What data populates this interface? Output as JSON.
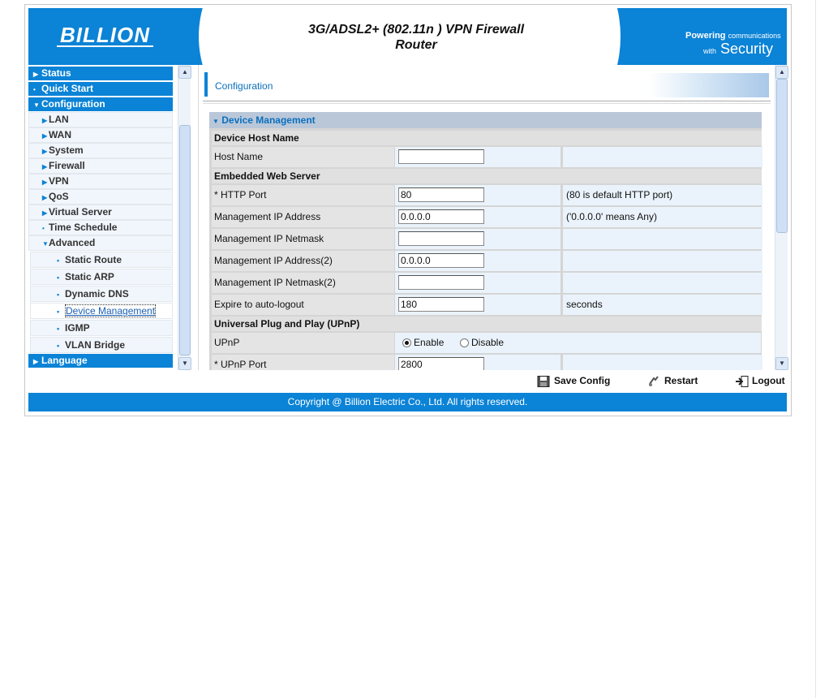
{
  "header": {
    "logo": "BILLION",
    "title": "3G/ADSL2+ (802.11n ) VPN Firewall Router",
    "powering": "Powering",
    "communications": "communications",
    "with": "with",
    "security": "Security"
  },
  "menu": {
    "status": "Status",
    "quick_start": "Quick Start",
    "configuration": "Configuration",
    "sub": [
      "LAN",
      "WAN",
      "System",
      "Firewall",
      "VPN",
      "QoS",
      "Virtual Server",
      "Time Schedule",
      "Advanced"
    ],
    "advanced_items": [
      "Static Route",
      "Static ARP",
      "Dynamic DNS",
      "Device Management",
      "IGMP",
      "VLAN Bridge"
    ],
    "language": "Language"
  },
  "content": {
    "title": "Configuration",
    "section_title": "Device Management",
    "groups": {
      "host": "Device Host Name",
      "web": "Embedded Web Server",
      "upnp": "Universal Plug and Play (UPnP)"
    },
    "rows": {
      "host_name": {
        "label": "Host Name",
        "value": ""
      },
      "http_port": {
        "label": "* HTTP Port",
        "value": "80",
        "note": "(80 is default HTTP port)"
      },
      "mgmt_ip": {
        "label": "Management IP Address",
        "value": "0.0.0.0",
        "note": "('0.0.0.0' means Any)"
      },
      "mgmt_mask": {
        "label": "Management IP Netmask",
        "value": "",
        "note": ""
      },
      "mgmt_ip2": {
        "label": "Management IP Address(2)",
        "value": "0.0.0.0"
      },
      "mgmt_mask2": {
        "label": "Management IP Netmask(2)",
        "value": ""
      },
      "expire": {
        "label": "Expire to auto-logout",
        "value": "180",
        "note": "seconds"
      },
      "upnp": {
        "label": "UPnP",
        "enable": "Enable",
        "disable": "Disable",
        "selected": "Enable"
      },
      "upnp_port": {
        "label": "* UPnP Port",
        "value": "2800"
      }
    }
  },
  "toolbar": {
    "save": "Save Config",
    "restart": "Restart",
    "logout": "Logout"
  },
  "footer": {
    "copyright": "Copyright @ Billion Electric Co., Ltd. All rights reserved."
  },
  "colors": {
    "brand_blue": "#0b83d6",
    "link_blue": "#0b6fbd"
  }
}
